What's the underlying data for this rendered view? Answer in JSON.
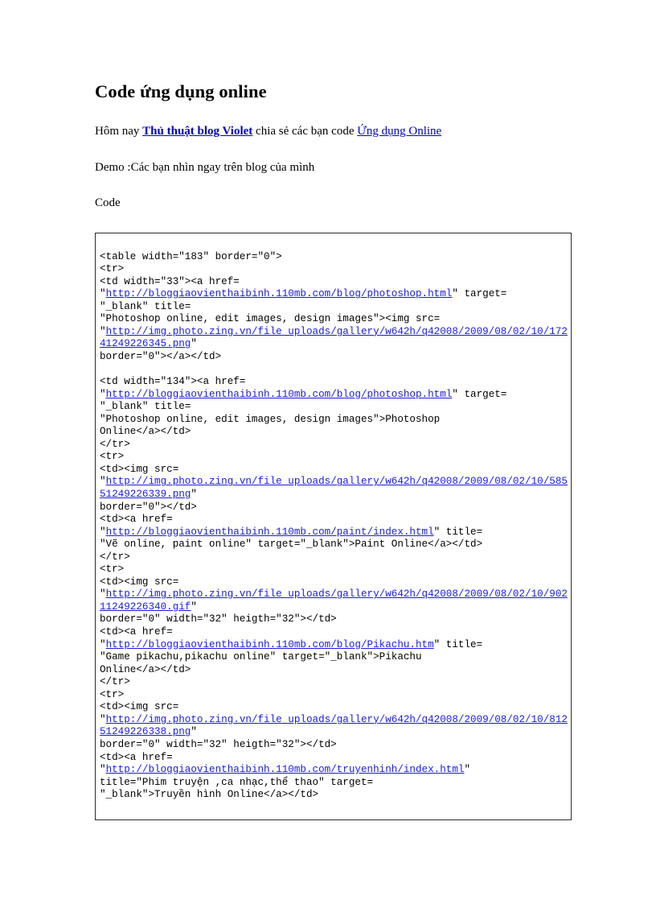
{
  "document": {
    "title": "Code ứng dụng online",
    "intro": {
      "before_link1": "Hôm nay ",
      "link1": "Thủ thuật blog Violet",
      "between_links": " chia sẻ các bạn code ",
      "link2": "Ứng dụng Online "
    },
    "demo_line": "Demo :Các bạn nhìn ngay trên blog của mình",
    "code_label": "Code",
    "link_color": "#0000cc",
    "code_link_color": "#1a1ae6",
    "code_border_color": "#2b2b2b"
  },
  "code_block": {
    "lines": [
      [
        {
          "t": "<table width=\"183\" border=\"0\">",
          "link": false
        }
      ],
      [
        {
          "t": "<tr>",
          "link": false
        }
      ],
      [
        {
          "t": "<td width=\"33\"><a href=",
          "link": false
        }
      ],
      [
        {
          "t": "\"",
          "link": false
        },
        {
          "t": "http://bloggiaovienthaibinh.110mb.com/blog/photoshop.html",
          "link": true
        },
        {
          "t": "\" target=",
          "link": false
        }
      ],
      [
        {
          "t": "\"_blank\" title=",
          "link": false
        }
      ],
      [
        {
          "t": "\"Photoshop online, edit images, design images\"><img src=",
          "link": false
        }
      ],
      [
        {
          "t": "\"",
          "link": false
        },
        {
          "t": "http://img.photo.zing.vn/file_uploads/gallery/w642h/q42008/2009/08/02/10/17241249226345.png",
          "link": true
        },
        {
          "t": "\"",
          "link": false
        }
      ],
      [
        {
          "t": "border=\"0\"></a></td>",
          "link": false
        }
      ],
      [],
      [
        {
          "t": "<td width=\"134\"><a href=",
          "link": false
        }
      ],
      [
        {
          "t": "\"",
          "link": false
        },
        {
          "t": "http://bloggiaovienthaibinh.110mb.com/blog/photoshop.html",
          "link": true
        },
        {
          "t": "\" target=",
          "link": false
        }
      ],
      [
        {
          "t": "\"_blank\" title=",
          "link": false
        }
      ],
      [
        {
          "t": "\"Photoshop online, edit images, design images\">Photoshop",
          "link": false
        }
      ],
      [
        {
          "t": "Online</a></td>",
          "link": false
        }
      ],
      [
        {
          "t": "</tr>",
          "link": false
        }
      ],
      [
        {
          "t": "<tr>",
          "link": false
        }
      ],
      [
        {
          "t": "<td><img src=",
          "link": false
        }
      ],
      [
        {
          "t": "\"",
          "link": false
        },
        {
          "t": "http://img.photo.zing.vn/file_uploads/gallery/w642h/q42008/2009/08/02/10/58551249226339.png",
          "link": true
        },
        {
          "t": "\"",
          "link": false
        }
      ],
      [
        {
          "t": "border=\"0\"></td>",
          "link": false
        }
      ],
      [
        {
          "t": "<td><a href=",
          "link": false
        }
      ],
      [
        {
          "t": "\"",
          "link": false
        },
        {
          "t": "http://bloggiaovienthaibinh.110mb.com/paint/index.html",
          "link": true
        },
        {
          "t": "\" title=",
          "link": false
        }
      ],
      [
        {
          "t": "\"Vẽ online, paint online\" target=\"_blank\">Paint Online</a></td>",
          "link": false
        }
      ],
      [
        {
          "t": "</tr>",
          "link": false
        }
      ],
      [
        {
          "t": "<tr>",
          "link": false
        }
      ],
      [
        {
          "t": "<td><img src=",
          "link": false
        }
      ],
      [
        {
          "t": "\"",
          "link": false
        },
        {
          "t": "http://img.photo.zing.vn/file_uploads/gallery/w642h/q42008/2009/08/02/10/90211249226340.gif",
          "link": true
        },
        {
          "t": "\"",
          "link": false
        }
      ],
      [
        {
          "t": "border=\"0\" width=\"32\" heigth=\"32\"></td>",
          "link": false
        }
      ],
      [
        {
          "t": "<td><a href=",
          "link": false
        }
      ],
      [
        {
          "t": "\"",
          "link": false
        },
        {
          "t": "http://bloggiaovienthaibinh.110mb.com/blog/Pikachu.htm",
          "link": true
        },
        {
          "t": "\" title=",
          "link": false
        }
      ],
      [
        {
          "t": "\"Game pikachu,pikachu online\" target=\"_blank\">Pikachu",
          "link": false
        }
      ],
      [
        {
          "t": "Online</a></td>",
          "link": false
        }
      ],
      [
        {
          "t": "</tr>",
          "link": false
        }
      ],
      [
        {
          "t": "<tr>",
          "link": false
        }
      ],
      [
        {
          "t": "<td><img src=",
          "link": false
        }
      ],
      [
        {
          "t": "\"",
          "link": false
        },
        {
          "t": "http://img.photo.zing.vn/file_uploads/gallery/w642h/q42008/2009/08/02/10/81251249226338.png",
          "link": true
        },
        {
          "t": "\"",
          "link": false
        }
      ],
      [
        {
          "t": "border=\"0\" width=\"32\" heigth=\"32\"></td>",
          "link": false
        }
      ],
      [
        {
          "t": "<td><a href=",
          "link": false
        }
      ],
      [
        {
          "t": "\"",
          "link": false
        },
        {
          "t": "http://bloggiaovienthaibinh.110mb.com/truyenhinh/index.html",
          "link": true
        },
        {
          "t": "\"",
          "link": false
        }
      ],
      [
        {
          "t": "title=\"Phim truyện ,ca nhạc,thể thao\" target=",
          "link": false
        }
      ],
      [
        {
          "t": "\"_blank\">Truyền hình Online</a></td>",
          "link": false
        }
      ]
    ]
  }
}
